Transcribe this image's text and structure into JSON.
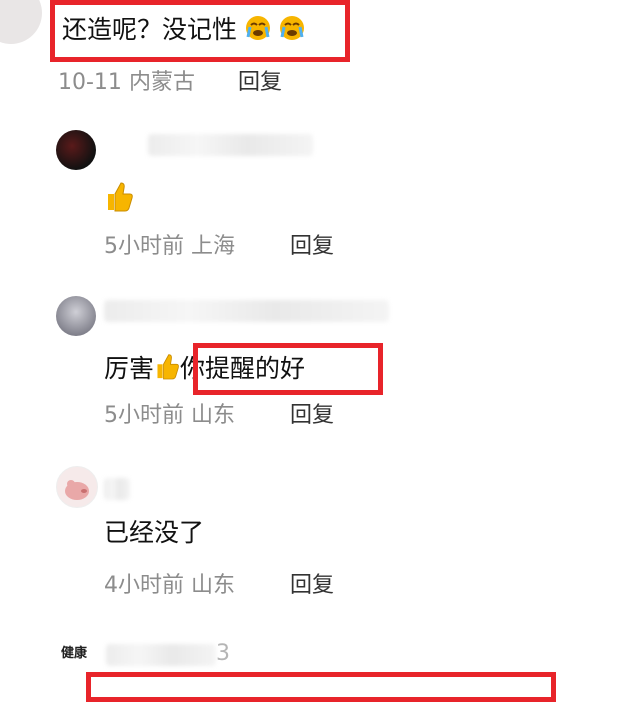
{
  "comments": [
    {
      "text": "还造呢？没记性",
      "emoji_icons": [
        "crying-face-icon",
        "crying-face-icon"
      ],
      "time": "10-11",
      "location": "内蒙古",
      "reply_label": "回复"
    },
    {
      "text": "",
      "emoji_icons": [
        "thumbs-up-icon"
      ],
      "time": "5小时前",
      "location": "上海",
      "reply_label": "回复"
    },
    {
      "text_before": "厉害",
      "emoji_icons": [
        "thumbs-up-icon"
      ],
      "text_after": "你提醒的好",
      "time": "5小时前",
      "location": "山东",
      "reply_label": "回复"
    },
    {
      "text": "已经没了",
      "time": "4小时前",
      "location": "山东",
      "reply_label": "回复"
    },
    {
      "name_suffix": "3",
      "avatar_text_lines": [
        "健康"
      ]
    }
  ],
  "colors": {
    "highlight_box": "#e8242a",
    "meta_text": "#8c8c8c",
    "emoji_yellow": "#f7b500"
  }
}
